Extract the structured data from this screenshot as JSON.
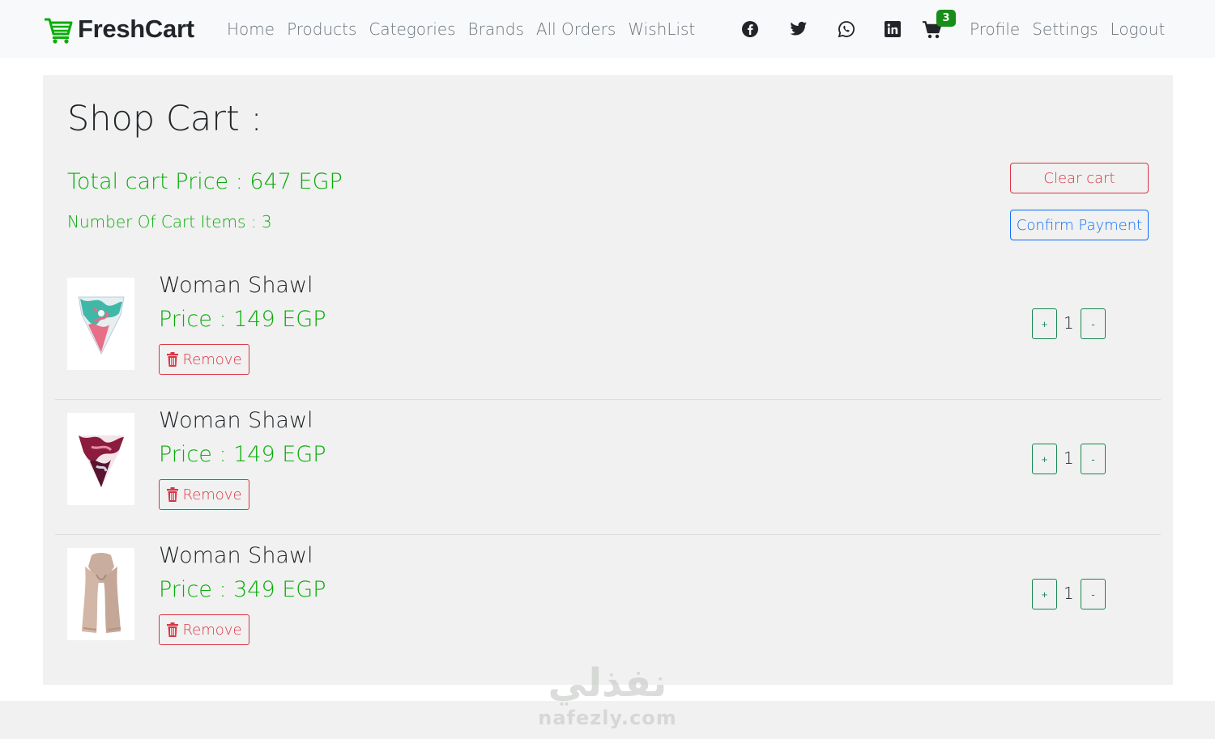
{
  "nav": {
    "brand": "FreshCart",
    "links_left": [
      "Home",
      "Products",
      "Categories",
      "Brands",
      "All Orders",
      "WishList"
    ],
    "social_icons": [
      "facebook-icon",
      "twitter-icon",
      "whatsapp-icon",
      "linkedin-icon"
    ],
    "cart_count": "3",
    "links_right": [
      "Profile",
      "Settings",
      "Logout"
    ]
  },
  "cart": {
    "title": "Shop Cart :",
    "total_price": "Total cart Price : 647 EGP",
    "item_count": "Number Of Cart Items : 3",
    "clear_label": "Clear cart",
    "confirm_label": "Confirm Payment",
    "items": [
      {
        "name": "Woman Shawl",
        "price": "Price : 149 EGP",
        "remove_label": "Remove",
        "plus": "+",
        "quantity": "1",
        "minus": "-",
        "image": "teal-pink-scarf"
      },
      {
        "name": "Woman Shawl",
        "price": "Price : 149 EGP",
        "remove_label": "Remove",
        "plus": "+",
        "quantity": "1",
        "minus": "-",
        "image": "maroon-scarf"
      },
      {
        "name": "Woman Shawl",
        "price": "Price : 349 EGP",
        "remove_label": "Remove",
        "plus": "+",
        "quantity": "1",
        "minus": "-",
        "image": "beige-scarf"
      }
    ]
  },
  "watermark": {
    "arabic": "نفذلي",
    "latin": "nafezly.com"
  },
  "colors": {
    "brand_green": "#0aad0a",
    "danger": "#dc3545",
    "primary": "#0d6efd",
    "success": "#198754"
  }
}
